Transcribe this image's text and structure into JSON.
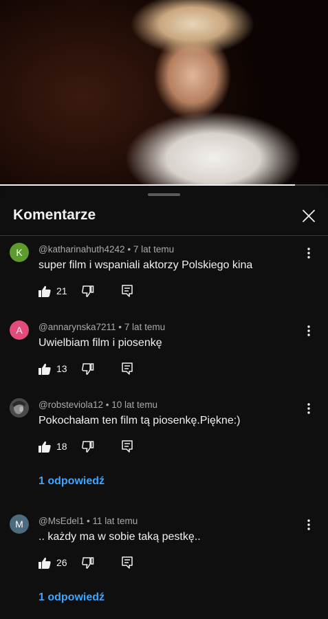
{
  "video": {
    "progress": 0.9
  },
  "sheet": {
    "title": "Komentarze"
  },
  "comments": [
    {
      "avatar_letter": "K",
      "avatar_color": "#5e9b2f",
      "author": "@katharinahuth4242",
      "time": "7 lat temu",
      "text": "super film i wspaniali aktorzy Polskiego kina",
      "likes": "21"
    },
    {
      "avatar_letter": "A",
      "avatar_color": "#e34b7a",
      "author": "@annarynska7211",
      "time": "7 lat temu",
      "text": "Uwielbiam film i piosenkę",
      "likes": "13"
    },
    {
      "avatar_letter": "",
      "avatar_color": "#5a5a5a",
      "author": "@robsteviola12",
      "time": "10 lat temu",
      "text": "Pokochałam ten film tą piosenkę.Piękne:)",
      "likes": "18",
      "replies": "1 odpowiedź"
    },
    {
      "avatar_letter": "M",
      "avatar_color": "#4d6b7e",
      "author": "@MsEdel1",
      "time": "11 lat temu",
      "text": ".. każdy ma w sobie taką pestkę..",
      "likes": "26",
      "replies": "1 odpowiedź"
    }
  ],
  "separator": "•",
  "icons": {
    "close": "close-icon",
    "more": "more-vertical-icon",
    "like": "thumb-up-icon",
    "dislike": "thumb-down-icon",
    "reply": "reply-icon"
  }
}
